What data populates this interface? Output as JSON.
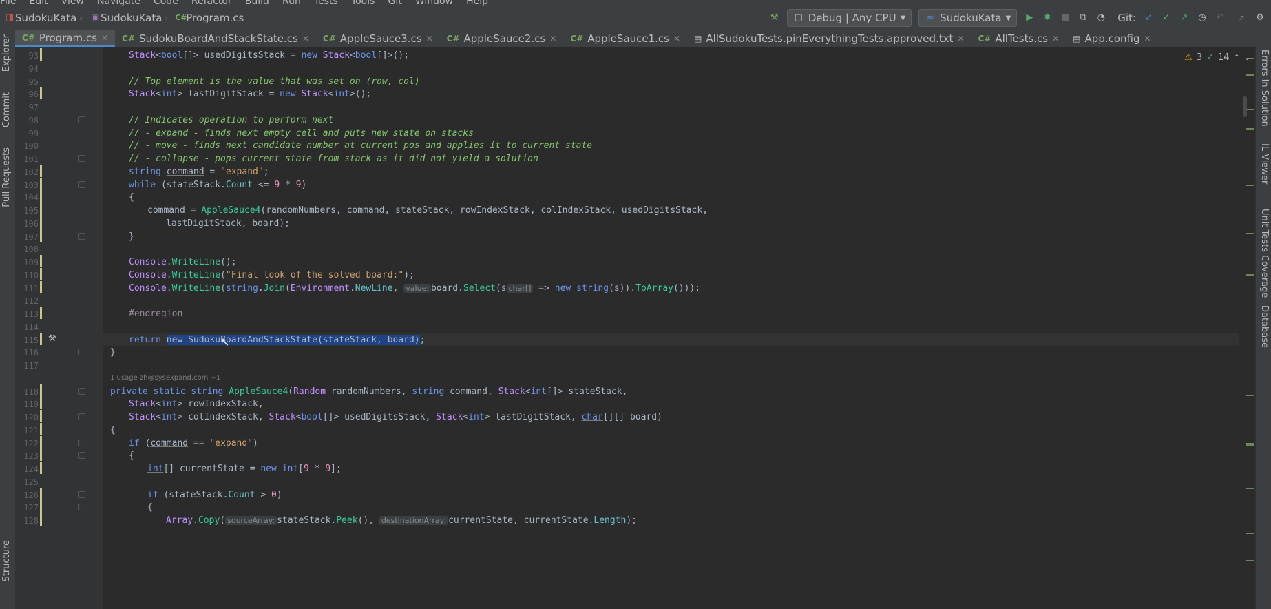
{
  "menu": [
    "File",
    "Edit",
    "View",
    "Navigate",
    "Code",
    "Refactor",
    "Build",
    "Run",
    "Tests",
    "Tools",
    "Git",
    "Window",
    "Help"
  ],
  "breadcrumb": [
    "SudokuKata",
    "SudokuKata",
    "Program.cs"
  ],
  "toolbar": {
    "configuration": "Debug | Any CPU",
    "run_target": "SudokuKata",
    "git_label": "Git:"
  },
  "tabs": [
    {
      "label": "Program.cs",
      "lang": "C#",
      "active": true
    },
    {
      "label": "SudokuBoardAndStackState.cs",
      "lang": "C#"
    },
    {
      "label": "AppleSauce3.cs",
      "lang": "C#"
    },
    {
      "label": "AppleSauce2.cs",
      "lang": "C#"
    },
    {
      "label": "AppleSauce1.cs",
      "lang": "C#"
    },
    {
      "label": "AllSudokuTests.pinEverythingTests.approved.txt",
      "lang": ""
    },
    {
      "label": "AllTests.cs",
      "lang": "C#"
    },
    {
      "label": "App.config",
      "lang": ""
    }
  ],
  "left_tool_windows": [
    "Explorer",
    "Commit",
    "Pull Requests",
    "Structure"
  ],
  "right_tool_windows": [
    "Errors In Solution",
    "IL Viewer",
    "Unit Tests Coverage",
    "Database"
  ],
  "inspection": {
    "warnings": "3",
    "ok": "14"
  },
  "codelens": {
    "usages": "1 usage",
    "author": "zh@sysexpand.com +1"
  },
  "line_numbers": [
    "93",
    "94",
    "95",
    "96",
    "97",
    "98",
    "99",
    "100",
    "101",
    "102",
    "103",
    "104",
    "105",
    "106",
    "107",
    "108",
    "109",
    "110",
    "111",
    "112",
    "113",
    "114",
    "115",
    "116",
    "117",
    "118",
    "119",
    "120",
    "121",
    "122",
    "123",
    "124",
    "125",
    "126",
    "127",
    "128"
  ],
  "code": {
    "l93": [
      "Stack",
      "<",
      "bool",
      "[]> usedDigitsStack = ",
      "new ",
      "Stack",
      "<",
      "bool",
      "[]>();"
    ],
    "l95": "// Top element is the value that was set on (row, col)",
    "l96": [
      "Stack",
      "<",
      "int",
      "> lastDigitStack = ",
      "new ",
      "Stack",
      "<",
      "int",
      ">();"
    ],
    "l98": "// Indicates operation to perform next",
    "l99": "// - expand - finds next empty cell and puts new state on stacks",
    "l100": "// - move - finds next candidate number at current pos and applies it to current state",
    "l101": "// - collapse - pops current state from stack as it did not yield a solution",
    "l102": [
      "string ",
      "command",
      " = ",
      "\"expand\"",
      ";"
    ],
    "l103": [
      "while ",
      "(stateStack.",
      "Count",
      " <= ",
      "9",
      " * ",
      "9",
      ")"
    ],
    "l104": "{",
    "l105": [
      "command",
      " = ",
      "AppleSauce4",
      "(randomNumbers, ",
      "command",
      ", stateStack, rowIndexStack, colIndexStack, usedDigitsStack,"
    ],
    "l106": "lastDigitStack, board);",
    "l107": "}",
    "l109": [
      "Console",
      ".",
      "WriteLine",
      "();"
    ],
    "l110": [
      "Console",
      ".",
      "WriteLine",
      "(",
      "\"Final look of the solved board:\"",
      ");"
    ],
    "l111": [
      "Console",
      ".",
      "WriteLine",
      "(",
      "string",
      ".",
      "Join",
      "(",
      "Environment",
      ".",
      "NewLine",
      ", ",
      "value:",
      "board.",
      "Select",
      "(s",
      "char[]",
      " => ",
      "new ",
      "string",
      "(s)).",
      "ToArray",
      "()));"
    ],
    "l113": "#endregion",
    "l115": [
      "return ",
      "new SudokuBoardAndStackState(stateStack, board)",
      ";"
    ],
    "l116": "}",
    "l118": [
      "private static string ",
      "AppleSauce4",
      "(",
      "Random",
      " randomNumbers, ",
      "string",
      " command, ",
      "Stack",
      "<",
      "int",
      "[]> stateStack,"
    ],
    "l119": [
      "Stack",
      "<",
      "int",
      "> rowIndexStack,"
    ],
    "l120": [
      "Stack",
      "<",
      "int",
      "> colIndexStack, ",
      "Stack",
      "<",
      "bool",
      "[]> usedDigitsStack, ",
      "Stack",
      "<",
      "int",
      "> lastDigitStack, ",
      "char",
      "[][] board)"
    ],
    "l121": "{",
    "l122": [
      "if ",
      "(",
      "command",
      " == ",
      "\"expand\"",
      ")"
    ],
    "l123": "{",
    "l124": [
      "int",
      "[] currentState = ",
      "new ",
      "int",
      "[",
      "9",
      " * ",
      "9",
      "];"
    ],
    "l126": [
      "if ",
      "(stateStack.",
      "Count",
      " > ",
      "0",
      ")"
    ],
    "l127": "{",
    "l128": [
      "Array",
      ".",
      "Copy",
      "(",
      "sourceArray:",
      "stateStack.",
      "Peek",
      "(), ",
      "destinationArray:",
      "currentState, currentState.",
      "Length",
      ");"
    ]
  },
  "colors": {
    "bg": "#2b2b2b",
    "keyword": "#6c95eb",
    "type": "#c191ff",
    "string": "#c9a26d",
    "comment": "#85c46c",
    "number": "#ed94c0",
    "method": "#39cc9b",
    "selection": "#214283"
  }
}
